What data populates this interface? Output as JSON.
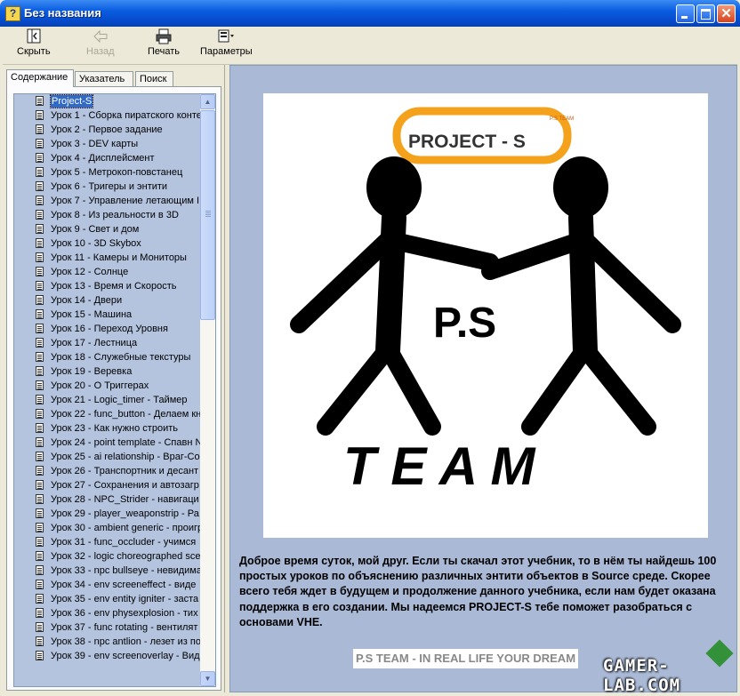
{
  "window": {
    "title": "Без названия"
  },
  "toolbar": {
    "hide_label": "Скрыть",
    "back_label": "Назад",
    "print_label": "Печать",
    "options_label": "Параметры"
  },
  "tabs": [
    {
      "label": "Содержание"
    },
    {
      "label": "Указатель"
    },
    {
      "label": "Поиск"
    }
  ],
  "tree": {
    "root": "Project-S",
    "items": [
      "Урок 1 - Сборка пиратского конте",
      "Урок 2 - Первое задание",
      "Урок 3 -  DEV карты",
      "Урок 4 - Дисплейсмент",
      "Урок 5 - Метрокоп-повстанец",
      "Урок 6 -  Тригеры и энтити",
      "Урок 7 - Управление летающим I",
      "Урок 8 - Из реальности в 3D",
      "Урок 9 - Свет и дом",
      "Урок 10 -  3D Skybox",
      "Урок 11 - Камеры и Мониторы",
      "Урок 12 - Солнце",
      "Урок 13 - Время и Скорость",
      "Урок 14 - Двери",
      "Урок 15 - Машина",
      "Урок 16 - Переход Уровня",
      "Урок 17 - Лестница",
      "Урок 18 - Служебные текстуры",
      "Урок 19 - Веревка",
      "Урок 20 - О Триггерах",
      "Урок 21 - Logic_timer - Таймер",
      "Урок 22 - func_button - Делаем кн",
      "Урок 23 - Как нужно строить",
      "Урок 24 - point template - Спавн N",
      "Урок 25 - ai relationship - Враг-Сог",
      "Урок 26 - Транспортник и десант",
      "Урок 27 - Сохранения и автозагр",
      "Урок 28  - NPC_Strider - навигаци",
      "Урок 29 - player_weaponstrip - Ра",
      "Урок 30 - ambient generic - проигр",
      "Урок 31 -  func_occluder - учимся",
      "Урок 32 - logic choreographed sce",
      "Урок 33 - npc bullseye - невидима",
      "Урок 34 - env screeneffect - виде",
      "Урок 35 - env entity igniter - заста",
      "Урок 36 - env physexplosion - тих",
      "Урок 37 - func rotating - вентилят",
      "Урок 38 - npc antlion - лезет из по",
      "Урок 39 - env screenoverlay - Вид"
    ]
  },
  "logo": {
    "badge_text": "PROJECT - S",
    "badge_small": "P.S TEAM",
    "center_text": "P.S",
    "bottom_text": "T E A M"
  },
  "content": {
    "intro": "Доброе время суток, мой друг. Если ты скачал этот учебник, то в нём ты найдешь 100 простых уроков по объяснению различных энтити объектов в Source среде. Скорее всего тебя ждет в будущем и продолжение данного учебника, если нам будет оказана поддержка в его создании. Мы надеемся PROJECT-S тебе поможет разобраться с основами VHE.",
    "tagline": "P.S TEAM - IN REAL LIFE YOUR DREAM"
  },
  "watermark": "GAMER-LAB.COM",
  "colors": {
    "titlebar": "#0a5de0",
    "tree_bg": "#b4c3de",
    "content_bg": "#a9b9d6",
    "badge_orange": "#f4a21c"
  }
}
